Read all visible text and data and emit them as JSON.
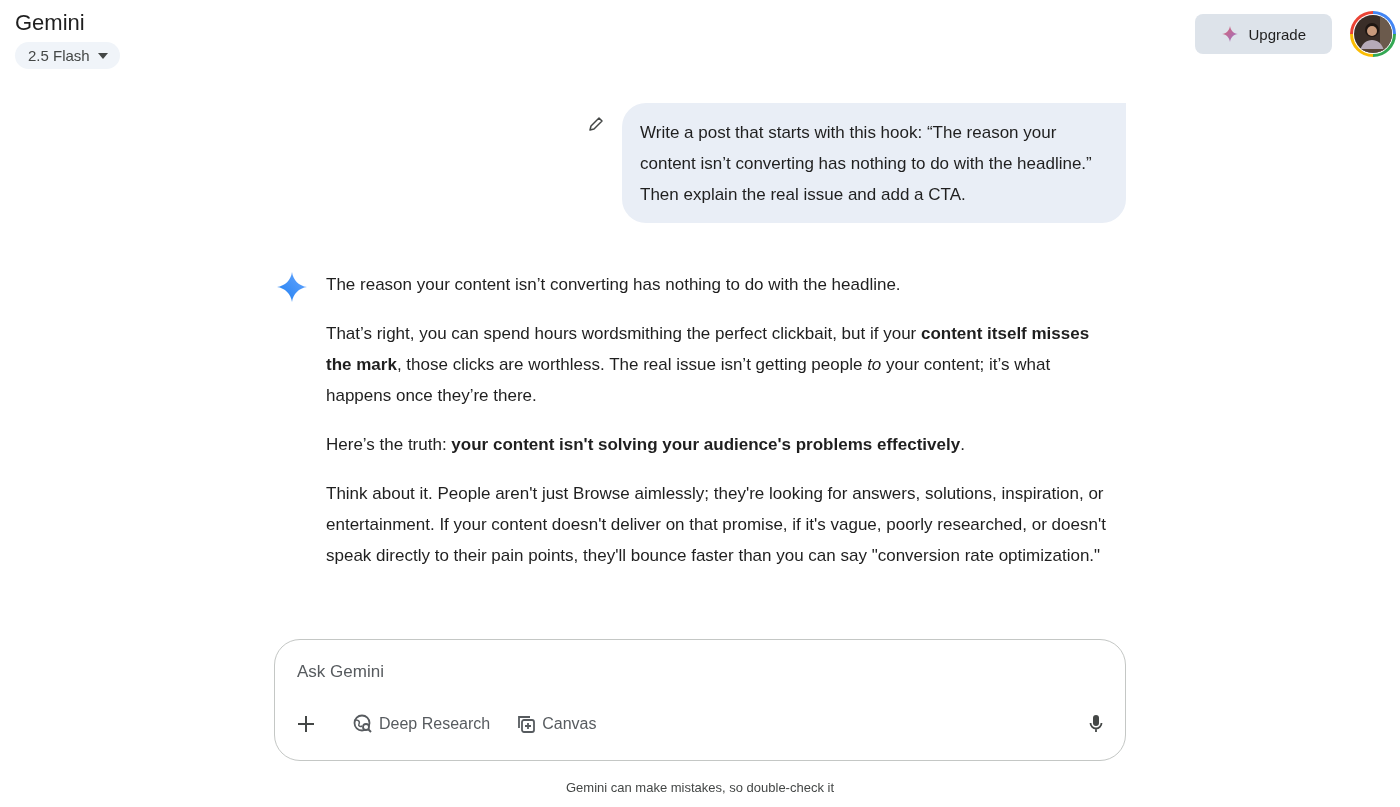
{
  "header": {
    "title": "Gemini",
    "model_selector": "2.5 Flash",
    "upgrade_button": "Upgrade"
  },
  "user_message": {
    "text": "Write a post that starts with this hook: “The reason your content isn’t converting has nothing to do with the headline.” Then explain the real issue and add a CTA."
  },
  "response": {
    "paragraphs": [
      "The reason your content isn’t converting has nothing to do with the headline.",
      "That’s right, you can spend hours wordsmithing the perfect clickbait, but if your **content itself misses the mark**, those clicks are worthless. The real issue isn’t getting people *to* your content; it’s what happens once they’re there.",
      "Here’s the truth: **your content isn't solving your audience's problems effectively**.",
      "Think about it. People aren't just Browse aimlessly; they're looking for answers, solutions, inspiration, or entertainment. If your content doesn't deliver on that promise, if it's vague, poorly researched, or doesn't speak directly to their pain points, they'll bounce faster than you can say \"conversion rate optimization.\""
    ]
  },
  "input": {
    "placeholder": "Ask Gemini",
    "tools": [
      {
        "label": "Deep Research",
        "kind": "research"
      },
      {
        "label": "Canvas",
        "kind": "canvas"
      }
    ]
  },
  "disclaimer": "Gemini can make mistakes, so double-check it"
}
